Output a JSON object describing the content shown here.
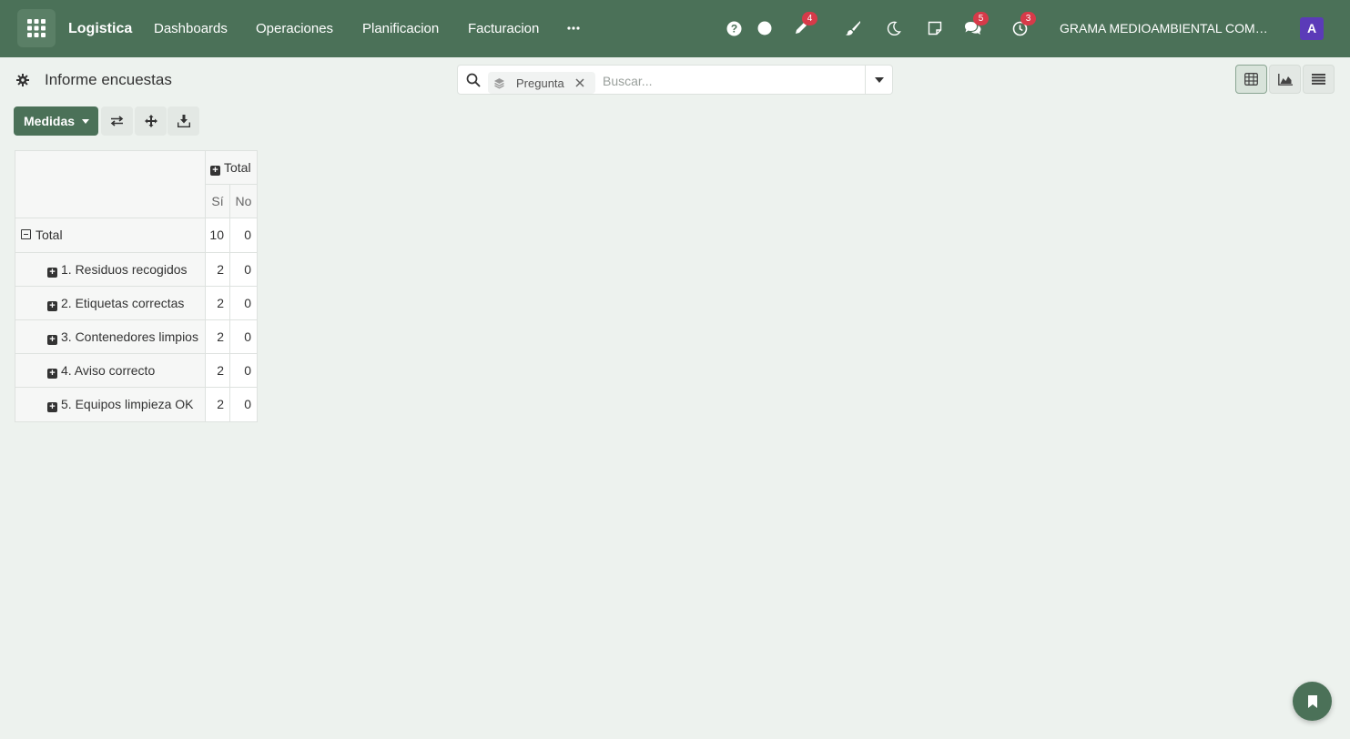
{
  "navbar": {
    "app_name": "Logistica",
    "menus": [
      "Dashboards",
      "Operaciones",
      "Planificacion",
      "Facturacion"
    ],
    "more_icon": "ellipsis-icon",
    "badges": {
      "activity": "4",
      "messages": "5",
      "clock": "3"
    },
    "company": "GRAMA MEDIOAMBIENTAL COMER...",
    "avatar_initial": "A"
  },
  "control_panel": {
    "title": "Informe encuestas",
    "search": {
      "facet_label": "Pregunta",
      "placeholder": "Buscar..."
    },
    "measures_label": "Medidas"
  },
  "pivot": {
    "column_group_label": "Total",
    "columns": [
      "Sí",
      "No"
    ],
    "total_row": {
      "label": "Total",
      "values": [
        "10",
        "0"
      ]
    },
    "rows": [
      {
        "label": "1. Residuos recogidos",
        "values": [
          "2",
          "0"
        ]
      },
      {
        "label": "2. Etiquetas correctas",
        "values": [
          "2",
          "0"
        ]
      },
      {
        "label": "3. Contenedores limpios",
        "values": [
          "2",
          "0"
        ]
      },
      {
        "label": "4. Aviso correcto",
        "values": [
          "2",
          "0"
        ]
      },
      {
        "label": "5. Equipos limpieza OK",
        "values": [
          "2",
          "0"
        ]
      }
    ]
  },
  "colors": {
    "navbar": "#4b7158",
    "primary_button": "#4b7158",
    "badge": "#d73a49",
    "avatar": "#5b3bb8",
    "background": "#edf2ee"
  }
}
